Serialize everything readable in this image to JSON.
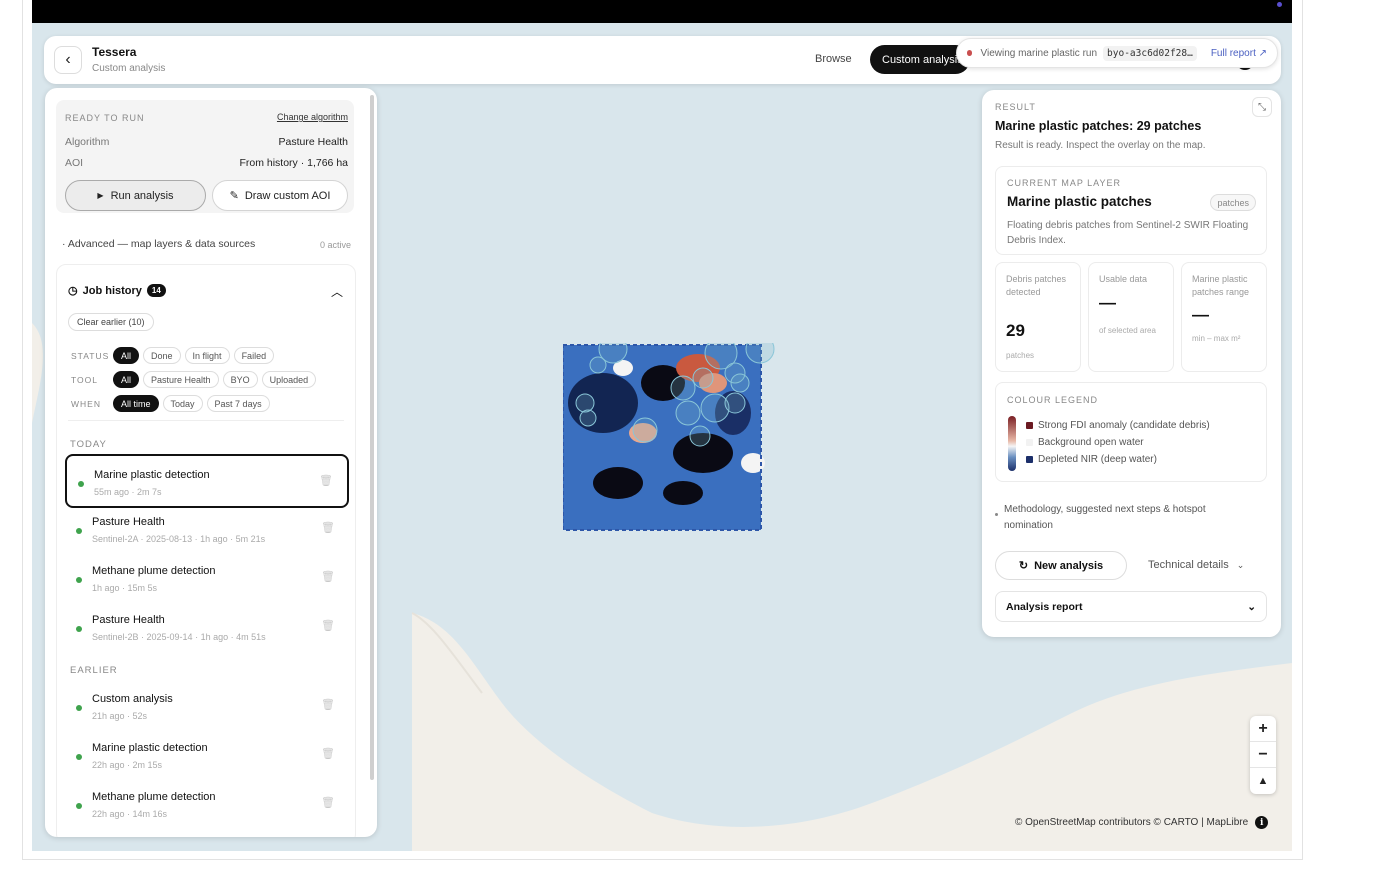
{
  "app": {
    "title": "Tessera",
    "subtitle": "Custom analysis"
  },
  "header": {
    "browse_label": "Browse",
    "custom_label": "Custom analysis",
    "viewing_text": "Viewing marine plastic run",
    "run_code": "byo-a3c6d02f28…",
    "full_report_label": "Full report ↗"
  },
  "run_card": {
    "ready_label": "READY TO RUN",
    "change_label": "Change algorithm",
    "algorithm_key": "Algorithm",
    "algorithm_value": "Pasture Health",
    "aoi_key": "AOI",
    "aoi_value": "From history · 1,766 ha",
    "run_label": "Run analysis",
    "draw_label": "Draw custom AOI"
  },
  "advanced": {
    "label": "Advanced — map layers & data sources",
    "active": "0 active"
  },
  "job_history": {
    "title": "Job history",
    "count": "14",
    "clear_label": "Clear earlier (10)",
    "filters": {
      "status_label": "STATUS",
      "status_chips": [
        "All",
        "Done",
        "In flight",
        "Failed"
      ],
      "tool_label": "TOOL",
      "tool_chips": [
        "All",
        "Pasture Health",
        "BYO",
        "Uploaded"
      ],
      "when_label": "WHEN",
      "when_chips": [
        "All time",
        "Today",
        "Past 7 days"
      ]
    },
    "today_label": "TODAY",
    "earlier_label": "EARLIER",
    "today_jobs": [
      {
        "title": "Marine plastic detection",
        "meta": "55m ago · 2m 7s"
      },
      {
        "title": "Pasture Health",
        "meta": "Sentinel-2A · 2025-08-13 · 1h ago · 5m 21s"
      },
      {
        "title": "Methane plume detection",
        "meta": "1h ago · 15m 5s"
      },
      {
        "title": "Pasture Health",
        "meta": "Sentinel-2B · 2025-09-14 · 1h ago · 4m 51s"
      }
    ],
    "earlier_jobs": [
      {
        "title": "Custom analysis",
        "meta": "21h ago · 52s"
      },
      {
        "title": "Marine plastic detection",
        "meta": "22h ago · 2m 15s"
      },
      {
        "title": "Methane plume detection",
        "meta": "22h ago · 14m 16s"
      }
    ]
  },
  "result": {
    "label": "RESULT",
    "title": "Marine plastic patches: 29 patches",
    "subtitle": "Result is ready. Inspect the overlay on the map.",
    "layer_caption": "CURRENT MAP LAYER",
    "layer_name": "Marine plastic patches",
    "layer_pill": "patches",
    "layer_desc": "Floating debris patches from Sentinel-2 SWIR Floating Debris Index.",
    "stats": [
      {
        "title": "Debris patches detected",
        "value": "29",
        "foot": "patches"
      },
      {
        "title": "Usable data",
        "value": "—",
        "foot": "of selected area"
      },
      {
        "title": "Marine plastic patches range",
        "value": "—",
        "foot": "min – max m²"
      }
    ],
    "legend_caption": "COLOUR LEGEND",
    "legend": [
      {
        "label": "Strong FDI anomaly (candidate debris)",
        "color": "#6b1a22"
      },
      {
        "label": "Background open water",
        "color": "#f2f2f2"
      },
      {
        "label": "Depleted NIR (deep water)",
        "color": "#1c2f6a"
      }
    ],
    "methodology": "Methodology, suggested next steps & hotspot nomination",
    "new_analysis_label": "New analysis",
    "technical_label": "Technical details",
    "report_label": "Analysis report"
  },
  "map": {
    "attribution": "© OpenStreetMap contributors © CARTO | MapLibre",
    "zoom_in": "+",
    "zoom_out": "−",
    "compass": "▲"
  },
  "colors": {
    "water": "#d9e6ec",
    "land": "#f2efe9",
    "accent": "#4a5fc1",
    "done": "#3fa34d"
  }
}
